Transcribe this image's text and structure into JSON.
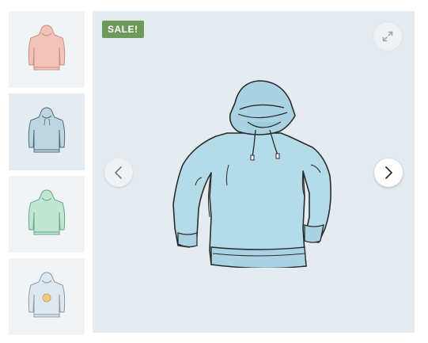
{
  "gallery": {
    "sale_badge": "SALE!",
    "active_index": 1,
    "thumbnails": [
      {
        "color": "#f2c3b8",
        "icon": "hoodie-pink-icon"
      },
      {
        "color": "#bcd6e2",
        "icon": "hoodie-blue-icon"
      },
      {
        "color": "#bfe7d3",
        "icon": "hoodie-green-icon"
      },
      {
        "color": "#dfe8ef",
        "icon": "hoodie-white-logo-icon"
      }
    ],
    "main_image_color": "#b4dbe8",
    "controls": {
      "zoom_icon": "expand-icon",
      "prev_icon": "chevron-left-icon",
      "next_icon": "chevron-right-icon"
    }
  }
}
